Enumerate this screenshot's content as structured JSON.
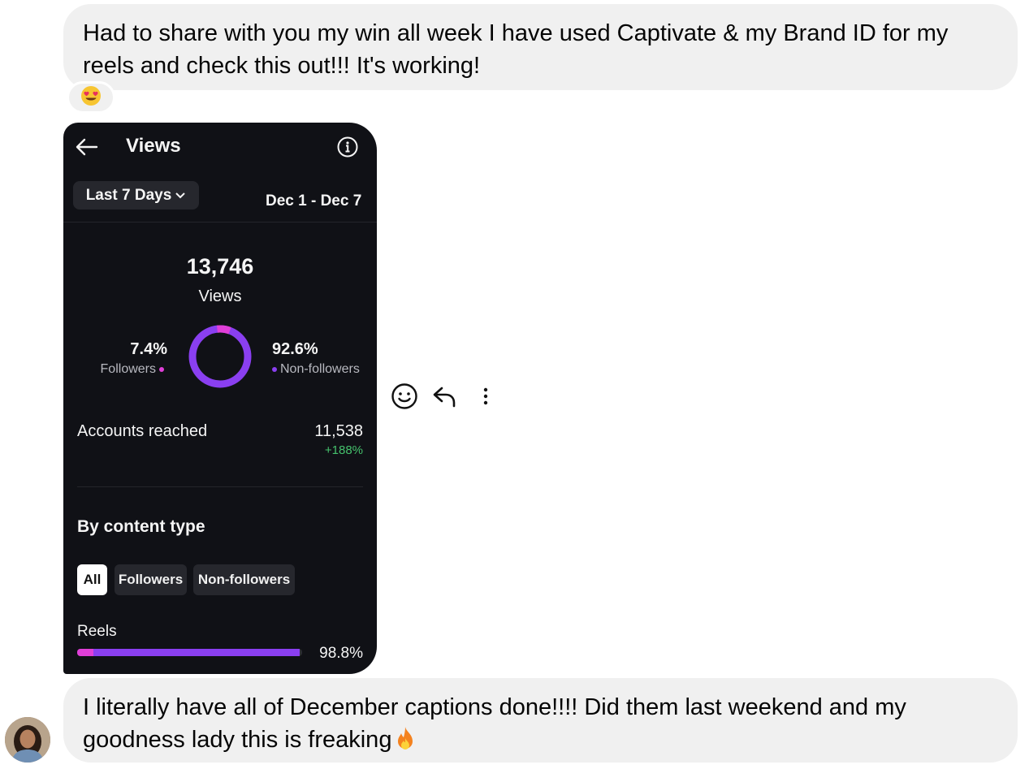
{
  "messages": {
    "top_text": "Had to share with you my win all week I have used Captivate & my Brand ID for my reels and check this out!!! It's working!",
    "bottom_text": "I literally have all of December captions done!!!! Did them last weekend and my goodness lady this is freaking"
  },
  "reaction": {
    "icon": "heart-eyes-emoji-icon"
  },
  "insights": {
    "title": "Views",
    "range_label": "Last 7 Days",
    "date_range": "Dec 1 - Dec 7",
    "total_views": "13,746",
    "total_views_label": "Views",
    "followers_pct": "7.4%",
    "followers_label": "Followers",
    "nonfollowers_pct": "92.6%",
    "nonfollowers_label": "Non-followers",
    "followers_fraction": 0.074,
    "accounts_reached_label": "Accounts reached",
    "accounts_reached_value": "11,538",
    "accounts_reached_change": "+188%",
    "by_content_type_title": "By content type",
    "filters": [
      "All",
      "Followers",
      "Non-followers"
    ],
    "reels_label": "Reels",
    "reels_pct": "98.8%",
    "reels_fraction": 0.988,
    "colors": {
      "followers": "#e03fd8",
      "nonfollowers": "#8a3ff0",
      "positive": "#45c16c",
      "card_bg": "#101116"
    }
  },
  "actions": {
    "icons": [
      "smiley-icon",
      "reply-icon",
      "more-icon"
    ]
  }
}
